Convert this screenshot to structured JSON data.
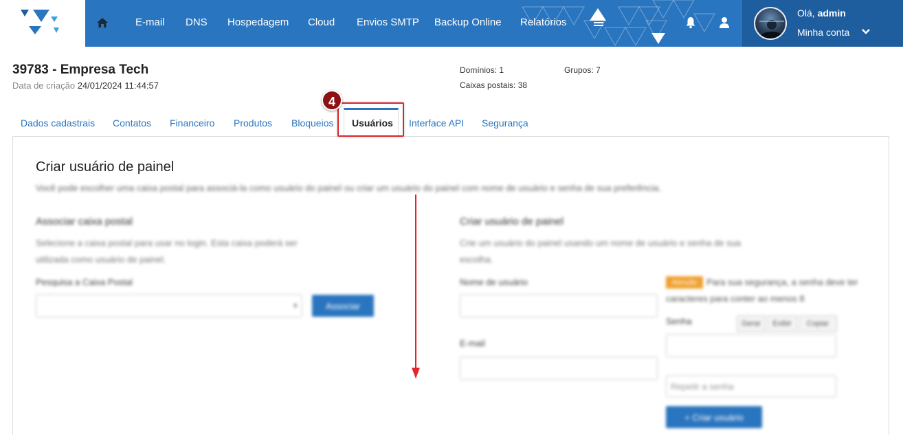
{
  "nav": {
    "links": [
      "E-mail",
      "DNS",
      "Hospedagem",
      "Cloud",
      "Envios SMTP",
      "Backup Online",
      "Relatórios"
    ],
    "greeting_prefix": "Olá,",
    "username": "admin",
    "my_account": "Minha conta"
  },
  "company": {
    "title": "39783 - Empresa Tech",
    "created_label": "Data de criação",
    "created_value": "24/01/2024 11:44:57",
    "domains": "Domínios: 1",
    "mailboxes": "Caixas postais: 38",
    "groups": "Grupos: 7"
  },
  "tabs": [
    "Dados cadastrais",
    "Contatos",
    "Financeiro",
    "Produtos",
    "Bloqueios",
    "Usuários",
    "Interface API",
    "Segurança"
  ],
  "active_tab": "Usuários",
  "annotation": {
    "step": "4"
  },
  "panel": {
    "title": "Criar usuário de painel",
    "description": "Você pode escolher uma caixa postal para associá-la como usuário do painel ou criar um usuário do painel com nome de usuário e senha de sua preferência.",
    "left": {
      "title": "Associar caixa postal",
      "text_line1": "Selecione a caixa postal para usar no login. Esta caixa poderá ser",
      "text_line2": "utilizada como usuário de painel.",
      "field_label": "Pesquisa a Caixa Postal",
      "associate_button": "Associar"
    },
    "right": {
      "title": "Criar usuário de painel",
      "text_line1": "Crie um usuário do painel usando um nome de usuário e senha de sua",
      "text_line2": "escolha.",
      "username_label": "Nome de usuário",
      "email_label": "E-mail",
      "warning_tag": "Atenção",
      "warning_line1": "Para sua segurança, a senha deve ter",
      "warning_line2": "caracteres para conter ao menos 8",
      "password_label": "Senha",
      "pw_buttons": [
        "Gerar",
        "Exibir",
        "Copiar"
      ],
      "repeat_placeholder": "Repetir a senha",
      "create_button": "Criar usuário"
    }
  },
  "colors": {
    "primary": "#2a75bf",
    "account_bg": "#1e5d9e",
    "highlight": "#d9262b",
    "badge": "#8b1115"
  }
}
